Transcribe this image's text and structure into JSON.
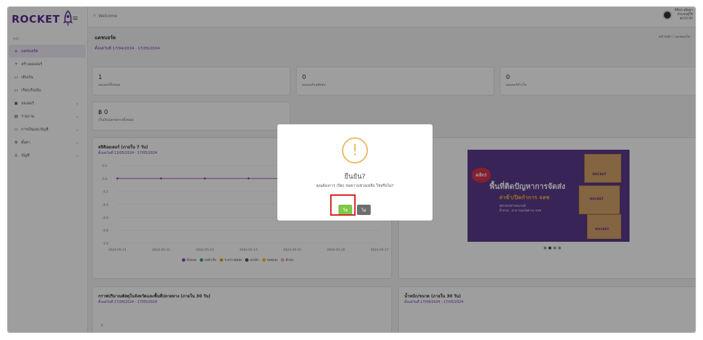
{
  "app": {
    "logo_text": "ROCKET"
  },
  "topbar": {
    "search_placeholder": "Welcome",
    "user": {
      "name": "ทิชินร ลลิษฐา",
      "role": "ตัวแทนผู้ใช้",
      "balance": "฿100.00"
    }
  },
  "sidebar": {
    "section": "หน้า",
    "items": [
      {
        "icon": "home-icon",
        "glyph": "⌂",
        "label": "แดชบอร์ด",
        "active": true
      },
      {
        "icon": "plus-icon",
        "glyph": "+",
        "label": "สร้างออเดอร์"
      },
      {
        "icon": "money-icon",
        "glyph": "▭",
        "label": "เติมเงิน"
      },
      {
        "icon": "wallet-icon",
        "glyph": "▭",
        "label": "เรียกเก็บเงิน"
      },
      {
        "icon": "box-icon",
        "glyph": "▣",
        "label": "ออเดอร์",
        "chevron": true
      },
      {
        "icon": "report-icon",
        "glyph": "▤",
        "label": "รายงาน",
        "chevron": true
      },
      {
        "icon": "finance-icon",
        "glyph": "▭",
        "label": "การเงินและบัญชี",
        "chevron": true
      },
      {
        "icon": "settings-icon",
        "glyph": "⚙",
        "label": "ตั้งค่า",
        "chevron": true
      },
      {
        "icon": "user-icon",
        "glyph": "♙",
        "label": "บัญชี",
        "chevron": true
      }
    ]
  },
  "page": {
    "title": "แดชบอร์ด",
    "date_range": "ตั้งแต่วันที่ 17/04/2024 - 17/05/2024",
    "breadcrumb": "หน้าหลัก / แดชบอร์ด"
  },
  "stats": [
    {
      "value": "1",
      "label": "ออเดอร์ทั้งหมด"
    },
    {
      "value": "0",
      "label": "ออเดอร์รอจัดส่ง"
    },
    {
      "value": "0",
      "label": "ออเดอร์สำเร็จ"
    },
    {
      "value": "฿ 0",
      "label": "เก็บเงินปลายทางทั้งหมด"
    }
  ],
  "order_chart": {
    "title": "สถิติออเดอร์ (ภายใน 7 วัน)",
    "subtitle": "ตั้งแต่วันที่ 11/05/2024 - 17/05/2024"
  },
  "chart_data": {
    "type": "line",
    "x": [
      "2024-05-11",
      "2024-05-12",
      "2024-05-13",
      "2024-05-14",
      "2024-05-15",
      "2024-05-16",
      "2024-05-17"
    ],
    "y_ticks": [
      "0.2",
      "0.0",
      "-0.2",
      "-0.4",
      "-0.6",
      "-0.8",
      "-1.0"
    ],
    "ylim": [
      -1.0,
      0.2
    ],
    "series": [
      {
        "name": "ทั้งหมด",
        "color": "#8e44ad",
        "values": [
          0,
          0,
          0,
          0,
          0,
          0,
          0
        ]
      }
    ],
    "legend": [
      {
        "name": "ทั้งหมด",
        "color": "#8e44ad"
      },
      {
        "name": "ส่งสำเร็จ",
        "color": "#27ae60"
      },
      {
        "name": "ระหว่างจัดส่ง",
        "color": "#f39c12"
      },
      {
        "name": "ยกเลิก",
        "color": "#555555"
      },
      {
        "name": "รอจัดส่ง",
        "color": "#f1c40f"
      },
      {
        "name": "ตีกลับ",
        "color": "#f5a3d9"
      }
    ],
    "legend_position": "bottom"
  },
  "banner": {
    "click": "คลิก!",
    "title": "พื้นที่ติดปัญหาการจัดส่ง",
    "subtitle": "ล่าช้า/ปิดกำการ จลช",
    "line1": "จุดกล่องตามสแกนด์",
    "line2": "น้ำท่วม , สาธารณภัยต่างๆ จลช",
    "box_label": "ROCKET"
  },
  "bottom_left": {
    "title": "กราฟปริมาณพัสดุในจังหวัดและพื้นที่ปลายทาง (ภายใน 30 วัน)",
    "subtitle": "ตั้งแต่วันที่ 17/04/2024 - 17/05/2024",
    "y_first": "0"
  },
  "bottom_right": {
    "title": "น้ำหนัก/ขนาด (ภายใน 30 วัน)",
    "subtitle": "ตั้งแต่วันที่ 17/04/2024 - 17/05/2024"
  },
  "modal": {
    "title": "ยืนยัน?",
    "message": "คุณต้องการ (ปิด) ขอความช่วยเหลือ ใช่หรือไม่?",
    "confirm_label": "ใช่",
    "cancel_label": "ไม่"
  }
}
